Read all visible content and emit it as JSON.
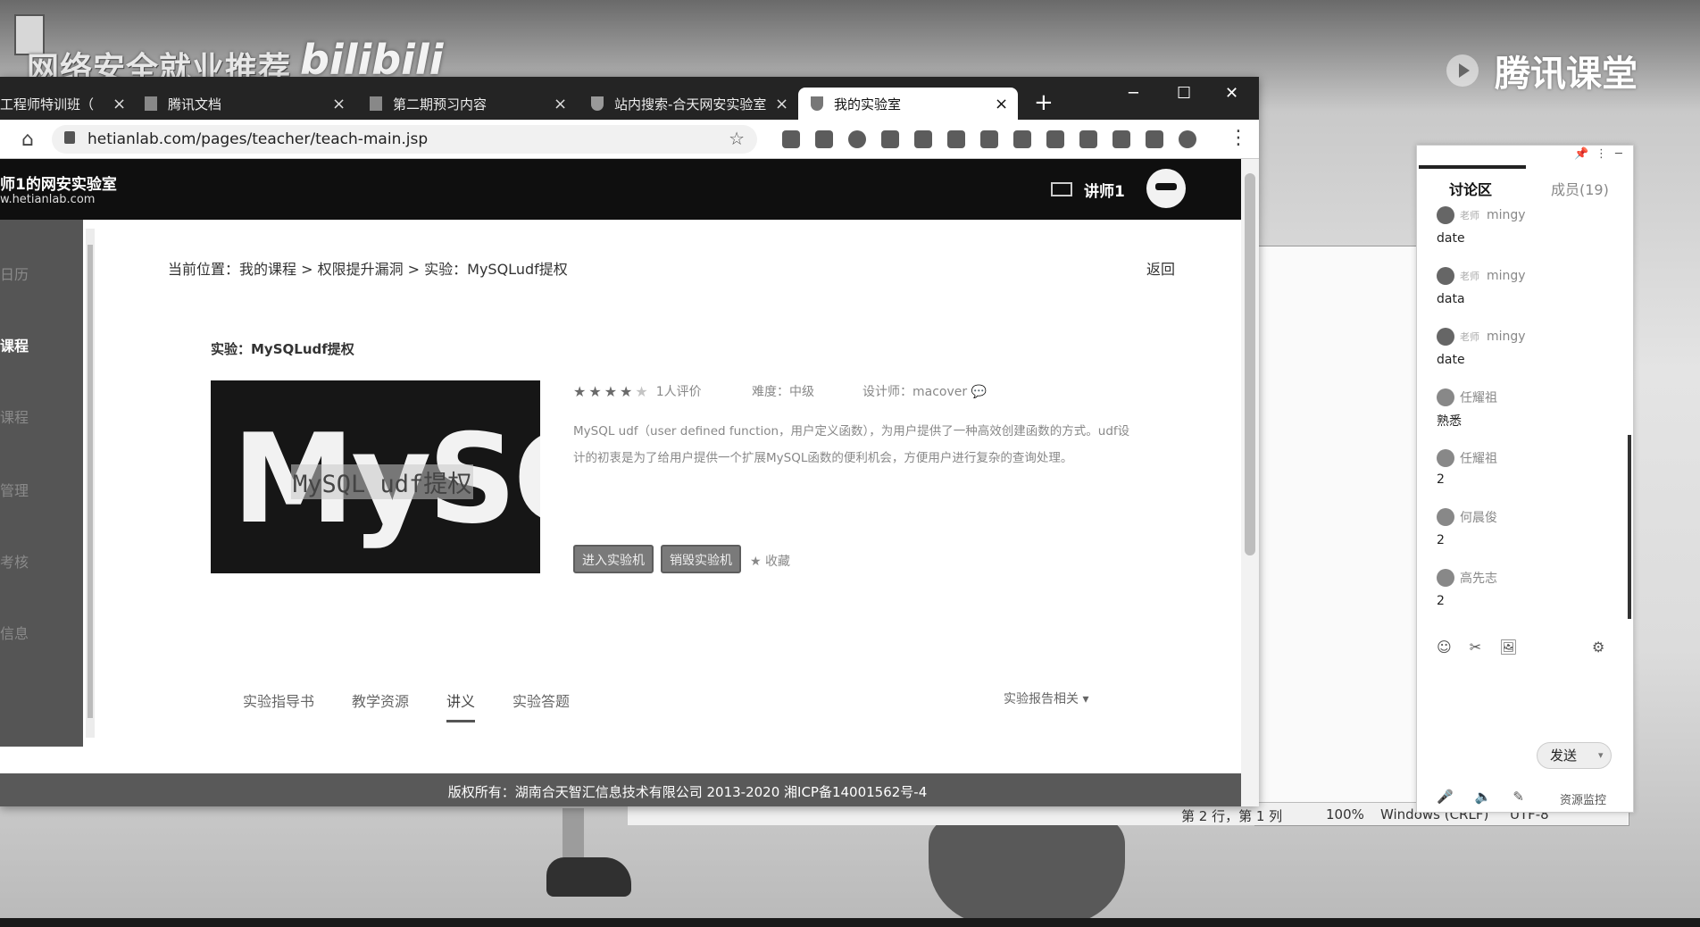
{
  "overlay": {
    "watermark": "网络安全就业推荐",
    "bili_logo": "bilibili",
    "tencent_brand": "腾讯课堂"
  },
  "browser": {
    "tabs": [
      {
        "label": "工程师特训班（",
        "active": false
      },
      {
        "label": "腾讯文档",
        "active": false
      },
      {
        "label": "第二期预习内容",
        "active": false
      },
      {
        "label": "站内搜索-合天网安实验室",
        "active": false
      },
      {
        "label": "我的实验室",
        "active": true
      }
    ],
    "tab_close": "×",
    "new_tab": "+",
    "window_controls": {
      "minimize": "─",
      "maximize": "☐",
      "close": "✕"
    },
    "url": "hetianlab.com/pages/teacher/teach-main.jsp",
    "star": "☆",
    "menu": "⋮",
    "home": "⌂"
  },
  "page": {
    "site_name": "师1的网安实验室",
    "site_url": "w.hetianlab.com",
    "teacher_name": "讲师1",
    "sidebar": [
      {
        "label": "日历",
        "active": false
      },
      {
        "label": "课程",
        "active": true
      },
      {
        "label": "课程",
        "active": false
      },
      {
        "label": "管理",
        "active": false
      },
      {
        "label": "考核",
        "active": false
      },
      {
        "label": "信息",
        "active": false
      }
    ],
    "breadcrumb": "当前位置：我的课程 > 权限提升漏洞 > 实验：MySQLudf提权",
    "back": "返回",
    "lab_title": "实验：MySQLudf提权",
    "image_big_text": "MySQL",
    "image_caption": "MySQL udf提权",
    "stars_filled": "★★★★",
    "stars_empty": "★",
    "rating_count": "1人评价",
    "difficulty": "难度：中级",
    "designer": "设计师：macover 💬",
    "description": "MySQL udf（user defined function，用户定义函数），为用户提供了一种高效创建函数的方式。udf设计的初衷是为了给用户提供一个扩展MySQL函数的便利机会，方便用户进行复杂的查询处理。",
    "btn_enter": "进入实验机",
    "btn_destroy": "销毁实验机",
    "favorite": "★ 收藏",
    "content_tabs": [
      "实验指导书",
      "教学资源",
      "讲义",
      "实验答题"
    ],
    "report_menu": "实验报告相关 ▾",
    "footer": "版权所有：湖南合天智汇信息技术有限公司 2013-2020 湘ICP备14001562号-4"
  },
  "notepad_status": {
    "position": "第 2 行，第 1 列",
    "zoom": "100%",
    "line_ending": "Windows (CRLF)",
    "encoding": "UTF-8"
  },
  "chat": {
    "controls": {
      "pin": "📌",
      "more": "⋮",
      "minimize": "─"
    },
    "tab_discussion": "讨论区",
    "tab_members": "成员(19)",
    "messages": [
      {
        "role": "老师",
        "name": "mingy",
        "text": "date"
      },
      {
        "role": "老师",
        "name": "mingy",
        "text": "data"
      },
      {
        "role": "老师",
        "name": "mingy",
        "text": "date"
      },
      {
        "role": "",
        "name": "任耀祖",
        "text": "熟悉"
      },
      {
        "role": "",
        "name": "任耀祖",
        "text": "2"
      },
      {
        "role": "",
        "name": "何晨俊",
        "text": "2"
      },
      {
        "role": "",
        "name": "高先志",
        "text": "2"
      }
    ],
    "tools": [
      "☺",
      "✂",
      "🖼"
    ],
    "tool_right": "⚙",
    "send": "发送",
    "send_caret": "▾",
    "bottom_icons": [
      "🎤",
      "🔈",
      "✎"
    ],
    "resource_monitor": "资源监控"
  }
}
